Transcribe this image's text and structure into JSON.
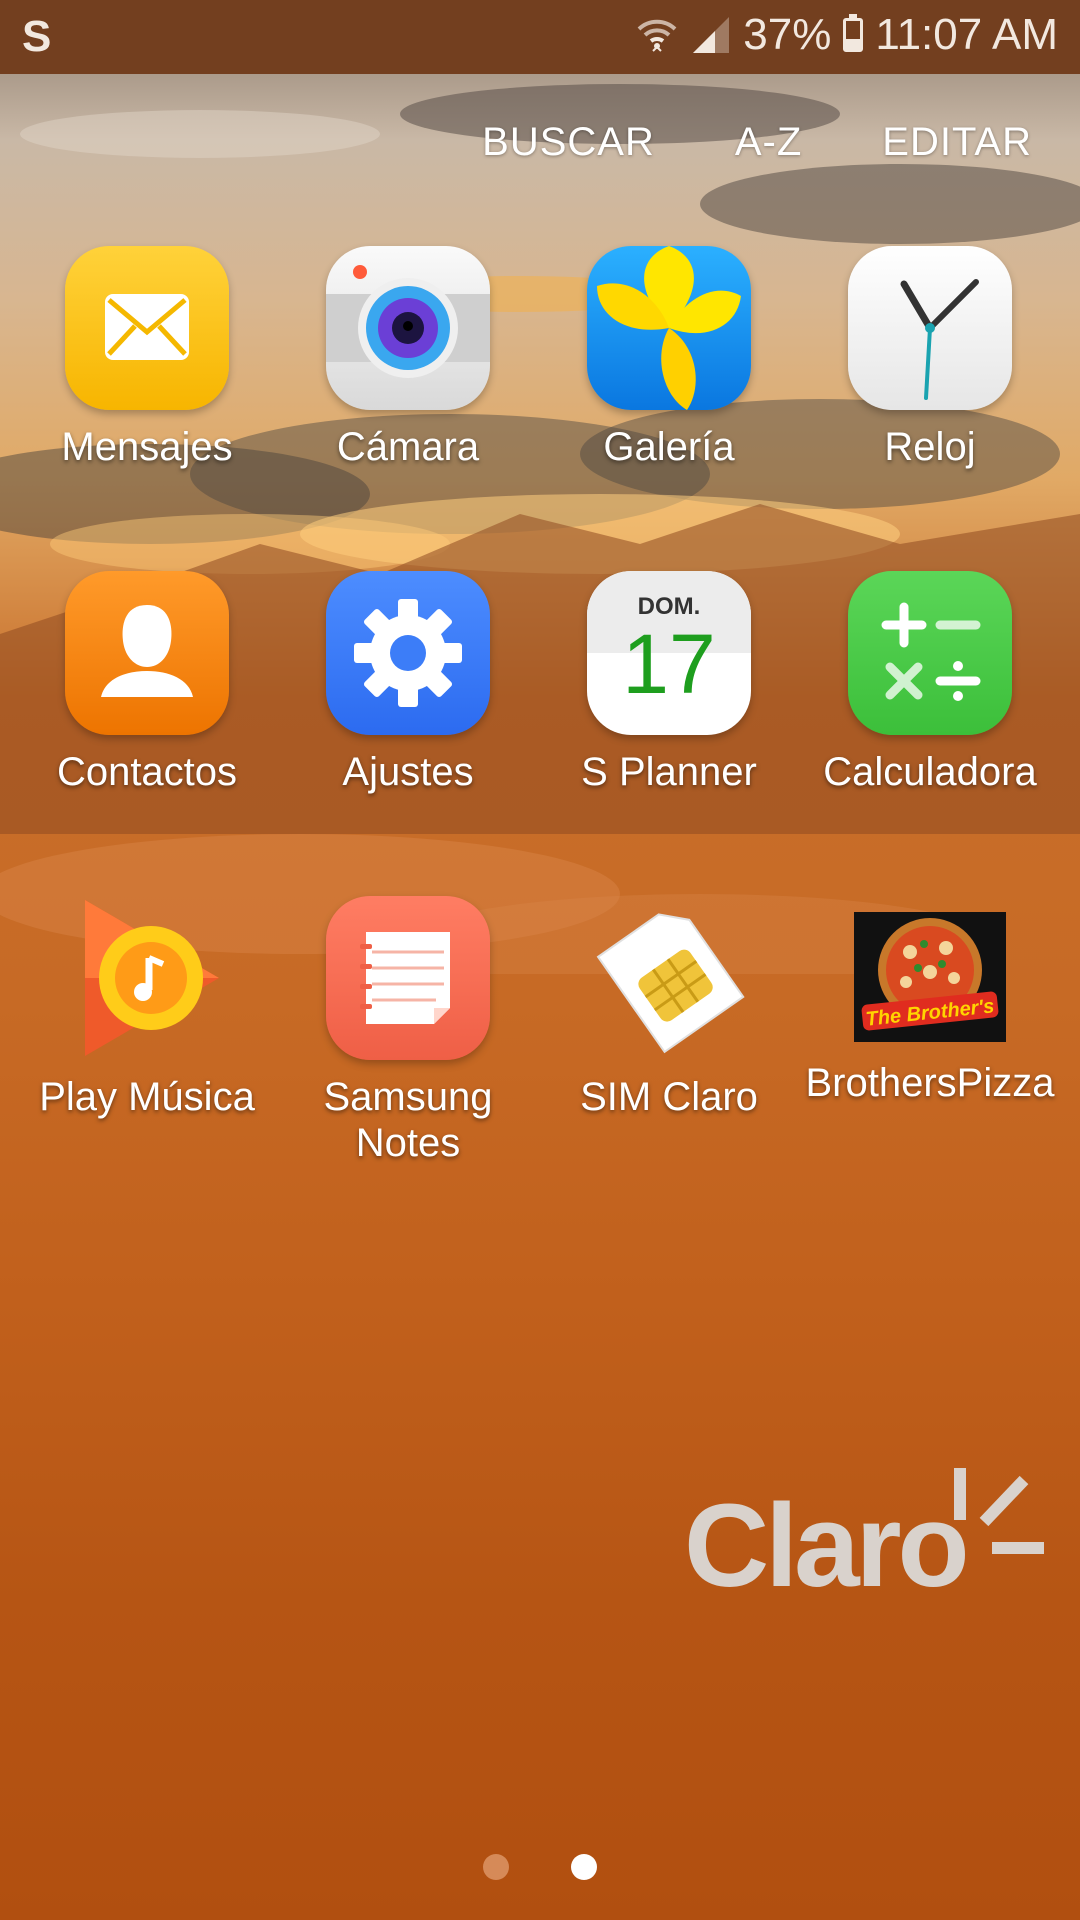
{
  "status_bar": {
    "left_icon": "samsung-s-icon",
    "battery_percent": "37%",
    "time": "11:07 AM",
    "battery_level": 0.37
  },
  "top_actions": {
    "search": "BUSCAR",
    "sort": "A-Z",
    "edit": "EDITAR"
  },
  "apps": [
    {
      "label": "Mensajes",
      "icon": "messages-icon"
    },
    {
      "label": "Cámara",
      "icon": "camera-icon"
    },
    {
      "label": "Galería",
      "icon": "gallery-icon"
    },
    {
      "label": "Reloj",
      "icon": "clock-icon"
    },
    {
      "label": "Contactos",
      "icon": "contacts-icon"
    },
    {
      "label": "Ajustes",
      "icon": "settings-icon"
    },
    {
      "label": "S Planner",
      "icon": "calendar-icon",
      "calendar_day": "DOM.",
      "calendar_date": "17"
    },
    {
      "label": "Calculadora",
      "icon": "calculator-icon"
    },
    {
      "label": "Play Música",
      "icon": "play-music-icon"
    },
    {
      "label": "Samsung Notes",
      "label_line1": "Samsung",
      "label_line2": "Notes",
      "icon": "notes-icon"
    },
    {
      "label": "SIM Claro",
      "icon": "sim-card-icon"
    },
    {
      "label": "BrothersPizza",
      "icon": "pizza-icon",
      "logo_text": "The Brother's"
    }
  ],
  "wallpaper_logo": "Claro",
  "pager": {
    "pages": 2,
    "current": 2
  }
}
